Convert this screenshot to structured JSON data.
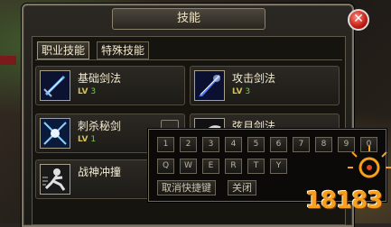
{
  "window": {
    "title": "技能",
    "close_symbol": "✕"
  },
  "tabs": [
    {
      "label": "职业技能",
      "active": true
    },
    {
      "label": "特殊技能",
      "active": false
    }
  ],
  "skills": [
    {
      "name": "基础剑法",
      "level_prefix": "LV",
      "level": "3"
    },
    {
      "name": "攻击剑法",
      "level_prefix": "LV",
      "level": "3"
    },
    {
      "name": "刺杀秘剑",
      "level_prefix": "LV",
      "level": "1"
    },
    {
      "name": "弦月剑法",
      "level_prefix": "",
      "level": ""
    },
    {
      "name": "战神冲撞",
      "level_prefix": "",
      "level": ""
    }
  ],
  "keypad": {
    "row1": [
      "1",
      "2",
      "3",
      "4",
      "5",
      "6",
      "7",
      "8",
      "9",
      "0"
    ],
    "row2": [
      "Q",
      "W",
      "E",
      "R",
      "T",
      "Y"
    ],
    "cancel_shortcut": "取消快捷键",
    "close": "关闭"
  },
  "watermark": {
    "text": "18183"
  }
}
